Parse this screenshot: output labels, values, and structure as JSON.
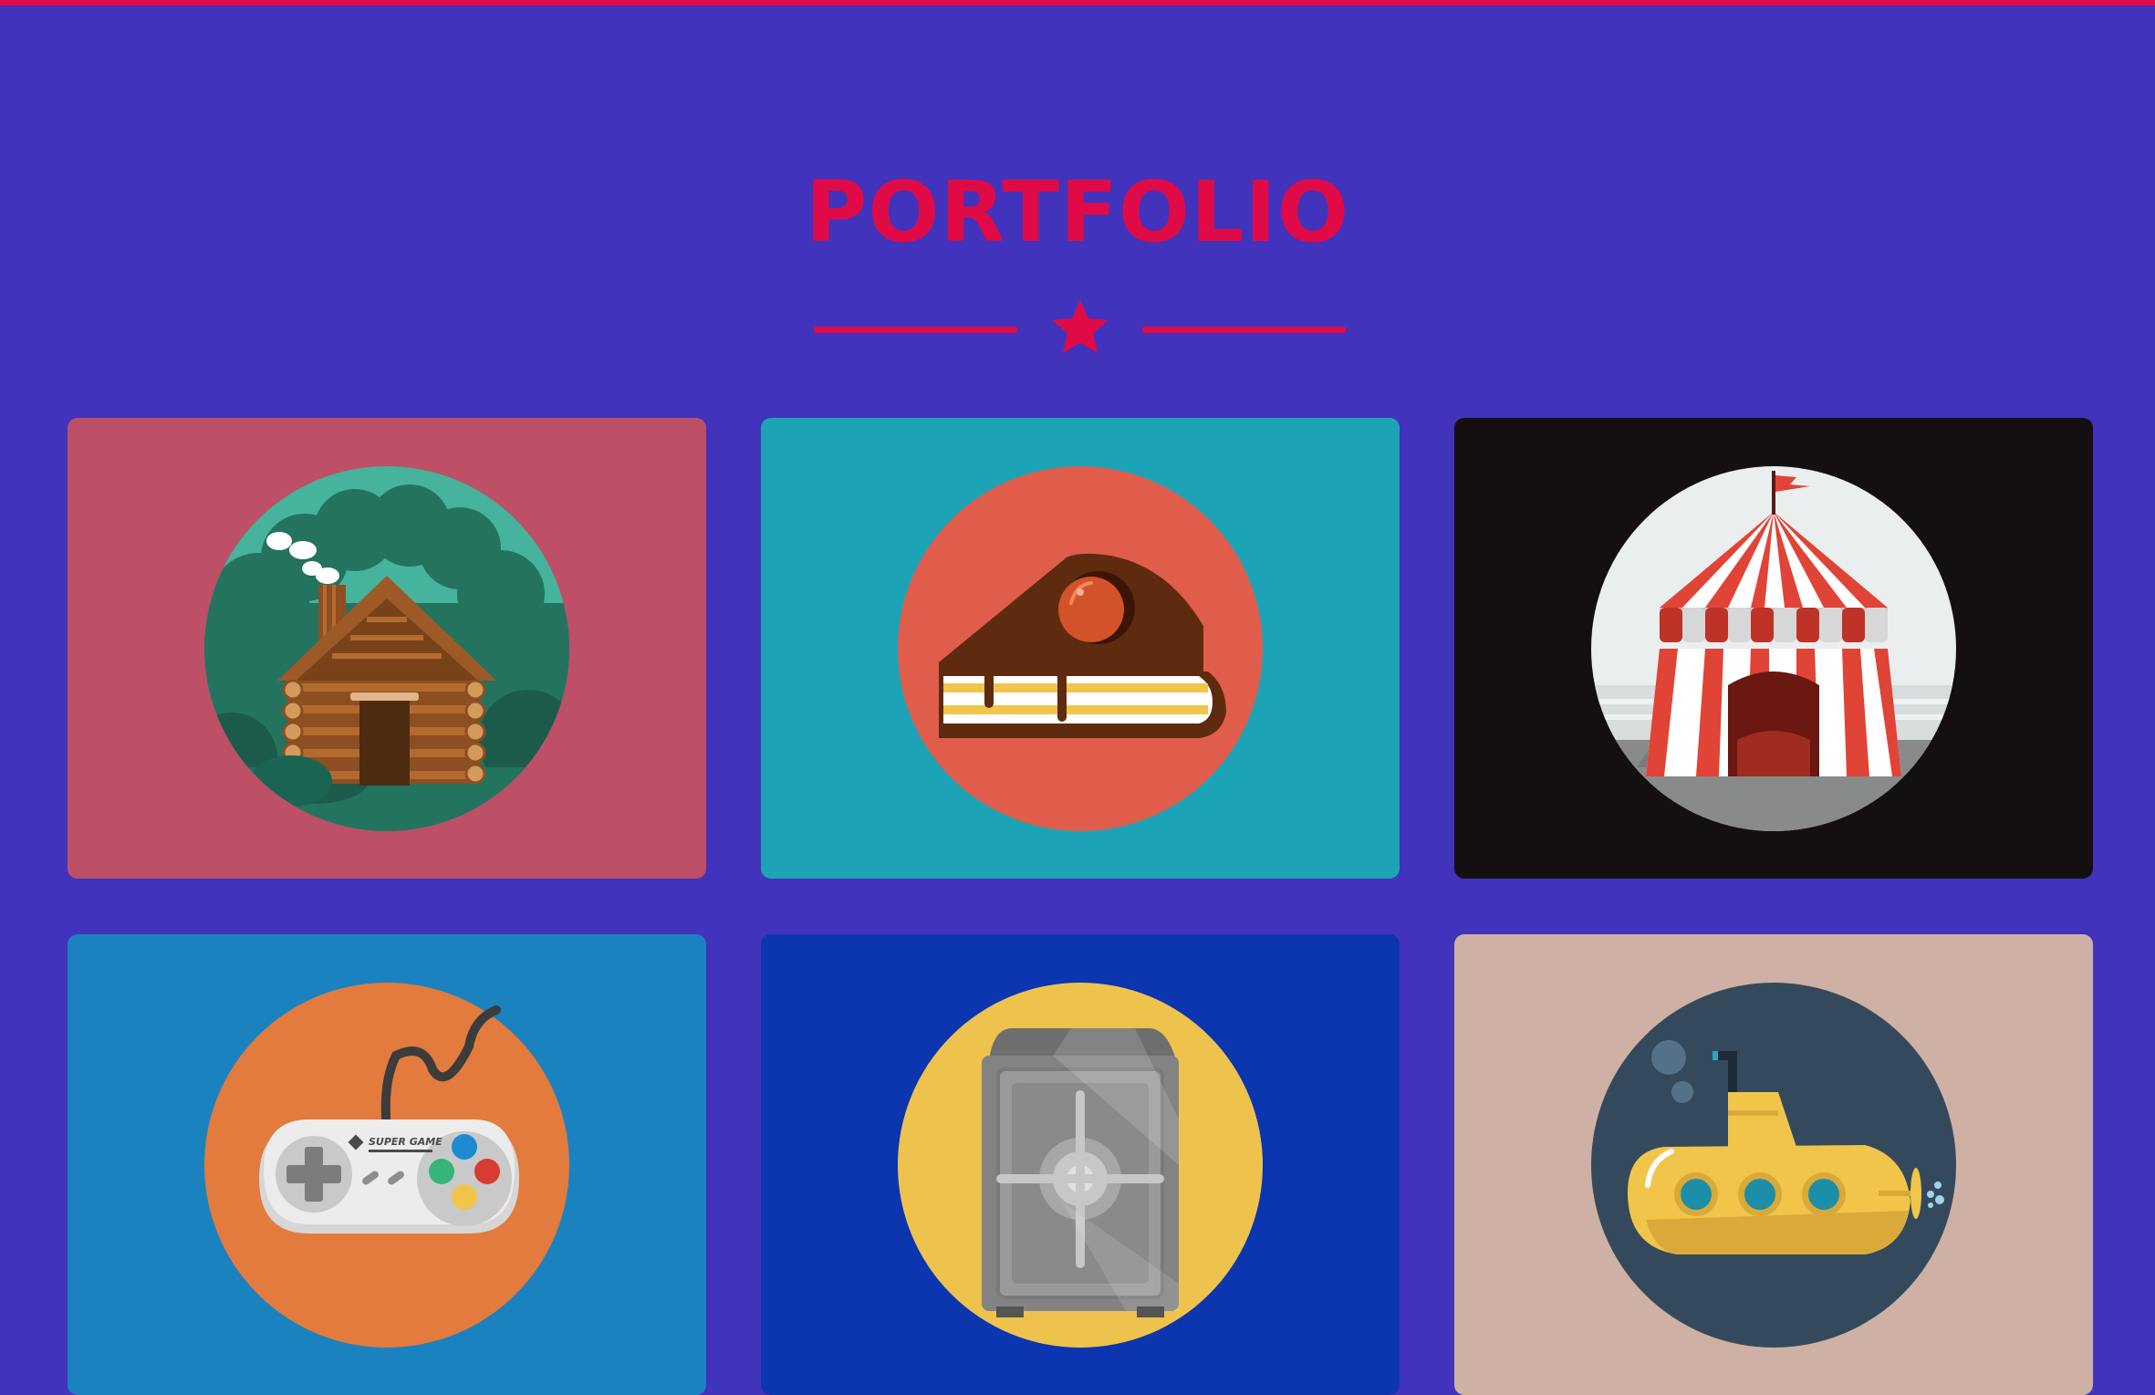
{
  "section": {
    "title": "PORTFOLIO"
  },
  "colors": {
    "background": "#4133bc",
    "accent": "#e00b46"
  },
  "portfolio": {
    "items": [
      {
        "icon": "log-cabin-icon",
        "bg": "#bd4f66"
      },
      {
        "icon": "cake-slice-icon",
        "bg": "#1ca4b6"
      },
      {
        "icon": "circus-tent-icon",
        "bg": "#141011"
      },
      {
        "icon": "game-controller-icon",
        "bg": "#1b82c0"
      },
      {
        "icon": "safe-icon",
        "bg": "#0c35b0"
      },
      {
        "icon": "submarine-icon",
        "bg": "#ceb1a4"
      }
    ],
    "controller_brand": "SUPER GAME"
  }
}
